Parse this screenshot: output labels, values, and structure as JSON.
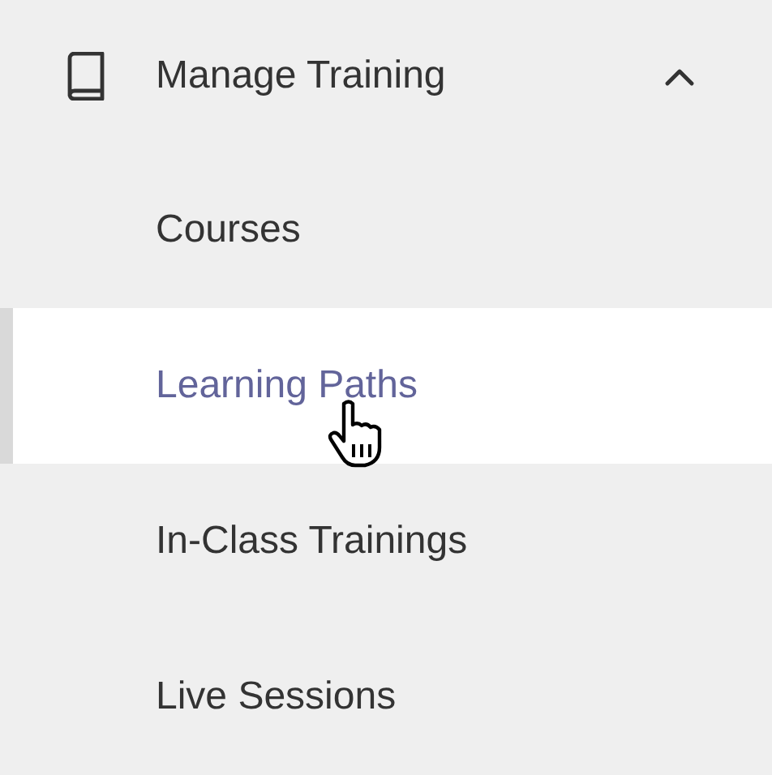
{
  "section": {
    "title": "Manage Training",
    "expanded": true
  },
  "items": [
    {
      "label": "Courses",
      "selected": false,
      "hovered": false
    },
    {
      "label": "Learning Paths",
      "selected": true,
      "hovered": true
    },
    {
      "label": "In-Class Trainings",
      "selected": false,
      "hovered": false
    },
    {
      "label": "Live Sessions",
      "selected": false,
      "hovered": false
    }
  ]
}
